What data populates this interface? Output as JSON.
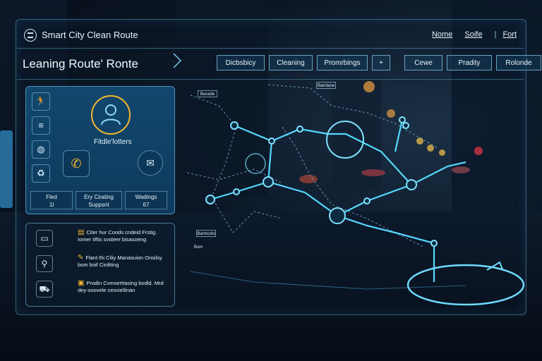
{
  "app": {
    "title": "Smart City Clean Route",
    "links": [
      "Nome",
      "Soife",
      "Fort"
    ],
    "separator": "|"
  },
  "header": {
    "page_title": "Leaning Route' Ronte",
    "tabs_left": [
      "Dicbsbicy",
      "Cleaning",
      "Promrbings",
      "+"
    ],
    "tabs_right": [
      "Cewe",
      "Pradity",
      "Rolonde"
    ]
  },
  "profile_card": {
    "label": "Fitdle'lotters",
    "stats": [
      {
        "top": "Fled",
        "bottom": "1l"
      },
      {
        "top": "Ery Cirating",
        "bottom": "Suppsnt"
      },
      {
        "top": "Wadings",
        "bottom": "67"
      }
    ]
  },
  "activity_list": {
    "items": [
      {
        "text": "Citer hur Coods cndeid Frstig. Iomer tiftis svsteer bisasoeng"
      },
      {
        "text": "Flant thi Ciliy Manasuion Onsilsy bom boif Cirditing"
      },
      {
        "text": "Prodin Cvmserttasing bodld. Mrd dey-soovele cesviellinan"
      }
    ]
  },
  "map_labels": [
    "Bucade",
    "Barntane",
    "Barmcolo",
    "Bum"
  ],
  "colors": {
    "accent": "#3fc4f0",
    "route": "#54d8ff",
    "ring": "#f3b72d"
  },
  "icons": [
    "run-icon",
    "layers-icon",
    "globe-icon",
    "recycle-icon",
    "user-icon",
    "phone-icon",
    "message-icon",
    "chat-icon",
    "search-people-icon",
    "car-icon"
  ]
}
